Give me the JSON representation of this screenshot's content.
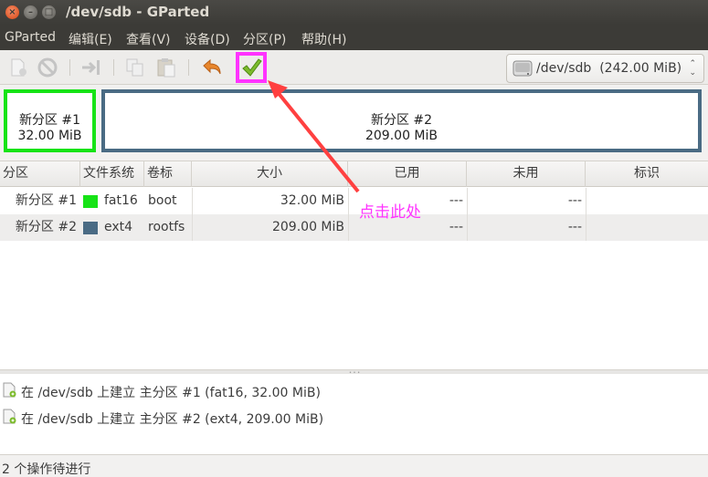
{
  "window": {
    "title": "/dev/sdb - GParted"
  },
  "menubar": {
    "items": [
      {
        "label": "GParted"
      },
      {
        "label": "编辑(E)"
      },
      {
        "label": "查看(V)"
      },
      {
        "label": "设备(D)"
      },
      {
        "label": "分区(P)"
      },
      {
        "label": "帮助(H)"
      }
    ]
  },
  "toolbar": {
    "buttons": [
      "new-partition",
      "delete",
      "resize-move",
      "copy",
      "paste",
      "undo",
      "apply"
    ],
    "highlighted": "apply",
    "highlight_color": "#ff33ff"
  },
  "device_selector": {
    "label": "/dev/sdb",
    "size": "(242.00 MiB)"
  },
  "partition_bar": {
    "partitions": [
      {
        "name": "新分区 #1",
        "size": "32.00 MiB",
        "color": "#16e316"
      },
      {
        "name": "新分区 #2",
        "size": "209.00 MiB",
        "color": "#4a6b84"
      }
    ]
  },
  "table": {
    "columns": [
      "分区",
      "文件系统",
      "卷标",
      "大小",
      "已用",
      "未用",
      "标识"
    ],
    "rows": [
      {
        "partition": "新分区 #1",
        "filesystem": "fat16",
        "fs_color": "#16e316",
        "label": "boot",
        "size": "32.00 MiB",
        "used": "---",
        "unused": "---",
        "flags": ""
      },
      {
        "partition": "新分区 #2",
        "filesystem": "ext4",
        "fs_color": "#4a6b84",
        "label": "rootfs",
        "size": "209.00 MiB",
        "used": "---",
        "unused": "---",
        "flags": ""
      }
    ]
  },
  "operations": [
    {
      "text": "在 /dev/sdb 上建立 主分区 #1 (fat16, 32.00 MiB)"
    },
    {
      "text": "在 /dev/sdb 上建立 主分区 #2 (ext4, 209.00 MiB)"
    }
  ],
  "status": {
    "text": "2 个操作待进行"
  },
  "annotation": {
    "text": "点击此处",
    "color": "#ff33ff"
  }
}
